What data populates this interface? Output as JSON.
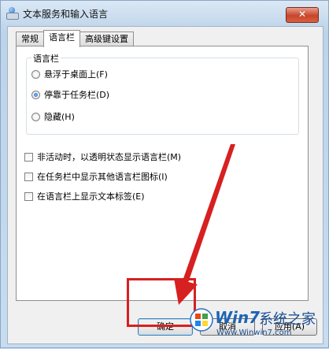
{
  "window": {
    "title": "文本服务和输入语言",
    "close_glyph": "✕"
  },
  "tabs": [
    {
      "label": "常规",
      "active": false
    },
    {
      "label": "语言栏",
      "active": true
    },
    {
      "label": "高级键设置",
      "active": false
    }
  ],
  "language_bar_group": {
    "label": "语言栏",
    "options": [
      {
        "label": "悬浮于桌面上(F)",
        "checked": false
      },
      {
        "label": "停靠于任务栏(D)",
        "checked": true
      },
      {
        "label": "隐藏(H)",
        "checked": false
      }
    ]
  },
  "checkboxes": [
    {
      "label": "非活动时，以透明状态显示语言栏(M)",
      "checked": false
    },
    {
      "label": "在任务栏中显示其他语言栏图标(I)",
      "checked": false
    },
    {
      "label": "在语言栏上显示文本标签(E)",
      "checked": false
    }
  ],
  "buttons": {
    "ok": "确定",
    "cancel": "取消",
    "apply": "应用(A)"
  },
  "watermark": {
    "brand": "Win7",
    "title": "系统之家",
    "url": "Www.Winwin7.com"
  },
  "colors": {
    "annotation_red": "#d72020",
    "default_button_border": "#3c7fb1"
  }
}
